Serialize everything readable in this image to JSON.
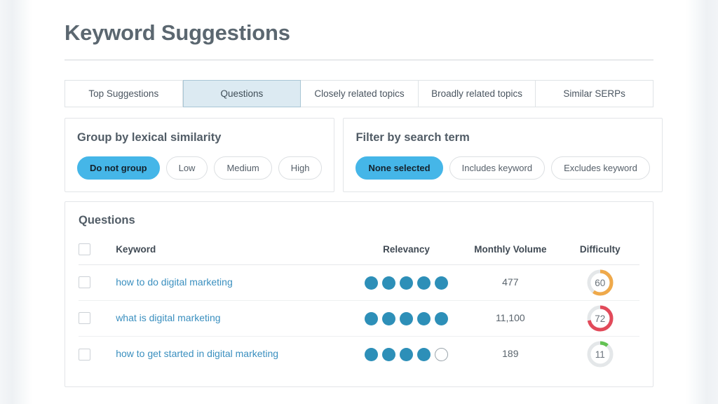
{
  "header": {
    "title": "Keyword Suggestions"
  },
  "tabs": [
    {
      "label": "Top Suggestions",
      "active": false
    },
    {
      "label": "Questions",
      "active": true
    },
    {
      "label": "Closely related topics",
      "active": false
    },
    {
      "label": "Broadly related topics",
      "active": false
    },
    {
      "label": "Similar SERPs",
      "active": false
    }
  ],
  "panels": [
    {
      "title": "Group by lexical similarity",
      "options": [
        {
          "label": "Do not group",
          "active": true
        },
        {
          "label": "Low",
          "active": false
        },
        {
          "label": "Medium",
          "active": false
        },
        {
          "label": "High",
          "active": false
        }
      ]
    },
    {
      "title": "Filter by search term",
      "options": [
        {
          "label": "None selected",
          "active": true
        },
        {
          "label": "Includes keyword",
          "active": false
        },
        {
          "label": "Excludes keyword",
          "active": false
        }
      ]
    }
  ],
  "table": {
    "title": "Questions",
    "columns": {
      "keyword": "Keyword",
      "relevancy": "Relevancy",
      "volume": "Monthly Volume",
      "difficulty": "Difficulty"
    },
    "relevancy_max": 5,
    "rows": [
      {
        "keyword": "how to do digital marketing",
        "relevancy": 5,
        "volume": "477",
        "difficulty": 60,
        "difficulty_label": "60",
        "difficulty_color": "#efa94a"
      },
      {
        "keyword": "what is digital marketing",
        "relevancy": 5,
        "volume": "11,100",
        "difficulty": 72,
        "difficulty_label": "72",
        "difficulty_color": "#e24a5a"
      },
      {
        "keyword": "how to get started in digital marketing",
        "relevancy": 4,
        "volume": "189",
        "difficulty": 11,
        "difficulty_label": "11",
        "difficulty_color": "#63c253"
      }
    ]
  },
  "colors": {
    "accent_blue": "#45b6e8",
    "link_blue": "#3a8fbf",
    "dot_blue": "#2d8fb8",
    "ring_track": "#e4e7e9",
    "active_tab_bg": "#dceaf2",
    "title_gray": "#5b6770"
  }
}
